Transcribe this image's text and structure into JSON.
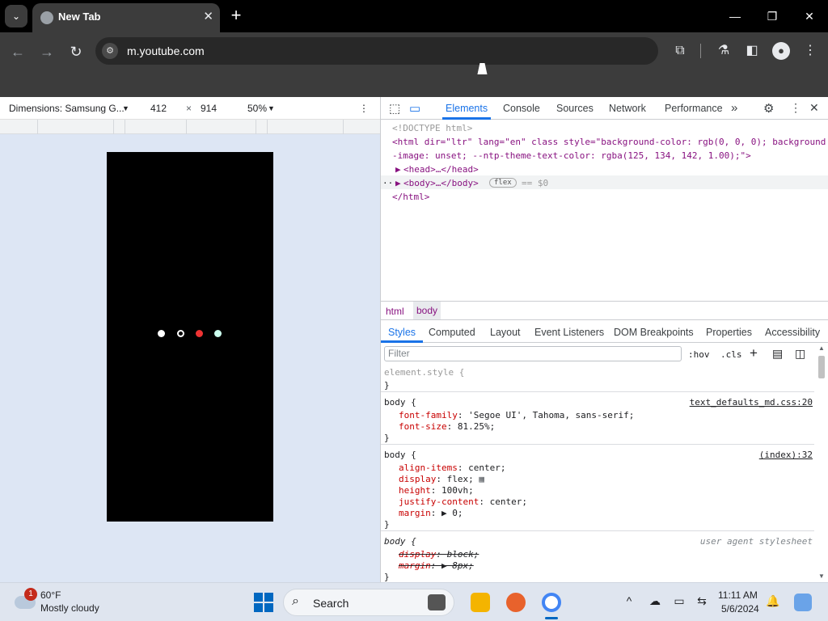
{
  "browser": {
    "tab": {
      "title": "New Tab",
      "favicon": "globe-icon",
      "close": "✕"
    },
    "new_tab": "+",
    "window": {
      "minimize": "—",
      "maximize": "❐",
      "close": "✕"
    },
    "url": "m.youtube.com",
    "toolbar_icons": [
      "back-icon",
      "forward-icon",
      "reload-icon",
      "site-info-icon",
      "extensions-icon",
      "labs-icon",
      "side-panel-icon",
      "profile-icon",
      "menu-icon"
    ]
  },
  "device_toolbar": {
    "device": "Dimensions: Samsung G...",
    "width": "412",
    "times": "×",
    "height": "914",
    "zoom": "50%",
    "more": "⋮"
  },
  "devtools": {
    "tabs": [
      "Elements",
      "Console",
      "Sources",
      "Network",
      "Performance"
    ],
    "more_tabs": "»",
    "active_tab": "Elements",
    "dom": {
      "doctype": "<!DOCTYPE html>",
      "html_open_1": "<html dir=\"ltr\" lang=\"en\" class style=\"background-color: rgb(0, 0, 0); background",
      "html_open_2": "-image: unset; --ntp-theme-text-color: rgba(125, 134, 142, 1.00);\">",
      "head": "<head>…</head>",
      "body": "<body>…</body>",
      "flex_badge": "flex",
      "body_ref": "== $0",
      "html_close": "</html>",
      "row_dots": "···"
    },
    "breadcrumbs": [
      "html",
      "body"
    ],
    "subtabs": [
      "Styles",
      "Computed",
      "Layout",
      "Event Listeners",
      "DOM Breakpoints",
      "Properties",
      "Accessibility"
    ],
    "filter_placeholder": "Filter",
    "filter_tools": {
      "hov": ":hov",
      "cls": ".cls",
      "add": "+"
    },
    "styles": {
      "element_style": "element.style {",
      "close": "}",
      "rule1": {
        "selector": "body {",
        "source": "text_defaults_md.css:20",
        "p1": "font-family",
        "v1": "'Segoe UI', Tahoma, sans-serif;",
        "p2": "font-size",
        "v2": "81.25%;"
      },
      "rule2": {
        "selector": "body {",
        "source": "(index):32",
        "p1": "align-items",
        "v1": "center;",
        "p2": "display",
        "v2": "flex;",
        "p3": "height",
        "v3": "100vh;",
        "p4": "justify-content",
        "v4": "center;",
        "p5": "margin",
        "v5": "▶ 0;"
      },
      "rule3": {
        "selector": "body {",
        "source": "user agent stylesheet",
        "p1": "display",
        "v1": "block;",
        "p2": "margin",
        "v2": "▶ 8px;"
      }
    }
  },
  "taskbar": {
    "weather_badge": "1",
    "temperature": "60°F",
    "condition": "Mostly cloudy",
    "search_label": "Search",
    "time": "11:11 AM",
    "date": "5/6/2024",
    "tray_icons": [
      "chevron-up-icon",
      "onedrive-icon",
      "display-icon",
      "network-icon",
      "notifications-icon",
      "copilot-icon"
    ]
  }
}
